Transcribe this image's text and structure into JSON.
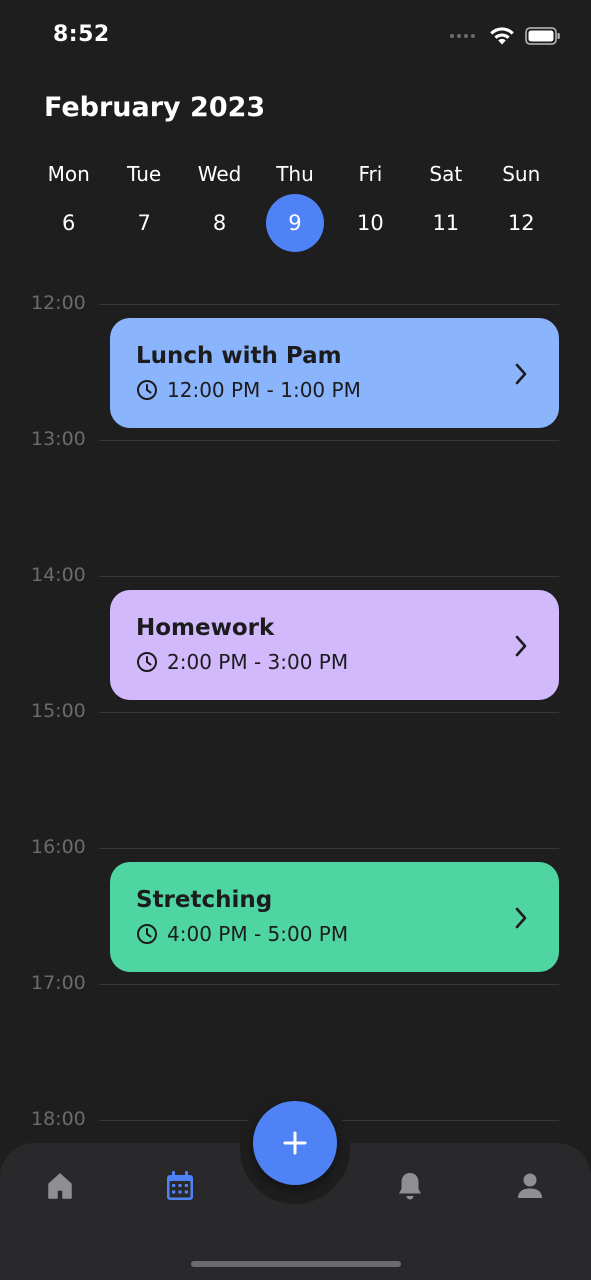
{
  "status_bar": {
    "time": "8:52"
  },
  "header": {
    "month_title": "February 2023"
  },
  "week": {
    "days": [
      {
        "name": "Mon",
        "date": "6"
      },
      {
        "name": "Tue",
        "date": "7"
      },
      {
        "name": "Wed",
        "date": "8"
      },
      {
        "name": "Thu",
        "date": "9"
      },
      {
        "name": "Fri",
        "date": "10"
      },
      {
        "name": "Sat",
        "date": "11"
      },
      {
        "name": "Sun",
        "date": "12"
      }
    ],
    "selected_date": "9"
  },
  "timeline": {
    "hours": [
      "12:00",
      "13:00",
      "14:00",
      "15:00",
      "16:00",
      "17:00",
      "18:00"
    ]
  },
  "events": [
    {
      "title": "Lunch with Pam",
      "time": "12:00 PM - 1:00 PM",
      "color": "#8ab4fc"
    },
    {
      "title": "Homework",
      "time": "2:00 PM - 3:00 PM",
      "color": "#d1b9fb"
    },
    {
      "title": "Stretching",
      "time": "4:00 PM - 5:00 PM",
      "color": "#4fd5a2"
    }
  ],
  "tabbar": {
    "tabs": [
      {
        "icon": "home-icon",
        "active": false
      },
      {
        "icon": "calendar-icon",
        "active": true
      },
      {
        "icon": "bell-icon",
        "active": false
      },
      {
        "icon": "profile-icon",
        "active": false
      }
    ],
    "fab_icon": "plus-icon"
  },
  "colors": {
    "background": "#1e1e1f",
    "accent": "#4f83f5",
    "muted": "#6b6b6e",
    "tabbar": "#29292b"
  }
}
